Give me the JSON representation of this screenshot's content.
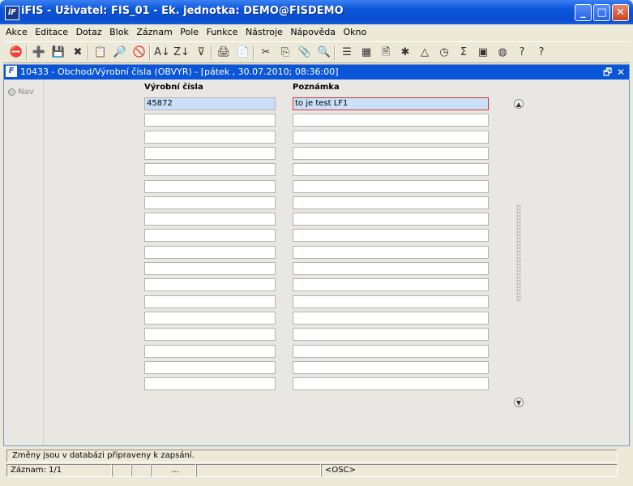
{
  "window": {
    "title": "iFIS - Uživatel: FIS_01 - Ek. jednotka: DEMO@FISDEMO",
    "app_icon": "iF",
    "minimize_icon": "_",
    "maximize_icon": "□",
    "close_icon": "✕"
  },
  "menu": [
    "Akce",
    "Editace",
    "Dotaz",
    "Blok",
    "Záznam",
    "Pole",
    "Funkce",
    "Nástroje",
    "Nápověda",
    "Okno"
  ],
  "toolbar": {
    "buttons": [
      {
        "icon": "exit-icon",
        "glyph": "⛔"
      },
      {
        "icon": "insert-record-icon",
        "glyph": "➕"
      },
      {
        "icon": "save-icon",
        "glyph": "💾"
      },
      {
        "icon": "delete-record-icon",
        "glyph": "✖"
      },
      {
        "icon": "query-icon",
        "glyph": "📋"
      },
      {
        "icon": "execute-query-icon",
        "glyph": "🔎"
      },
      {
        "icon": "cancel-query-icon",
        "glyph": "🚫"
      },
      {
        "icon": "sort-asc-icon",
        "glyph": "A↓"
      },
      {
        "icon": "sort-desc-icon",
        "glyph": "Z↓"
      },
      {
        "icon": "filter-icon",
        "glyph": "⊽"
      },
      {
        "icon": "print-icon",
        "glyph": "🖨"
      },
      {
        "icon": "print-preview-icon",
        "glyph": "📄"
      },
      {
        "icon": "cut-icon",
        "glyph": "✂"
      },
      {
        "icon": "copy-icon",
        "glyph": "⎘"
      },
      {
        "icon": "paste-icon",
        "glyph": "📎"
      },
      {
        "icon": "find-icon",
        "glyph": "🔍"
      },
      {
        "icon": "list-icon",
        "glyph": "☰"
      },
      {
        "icon": "columns-icon",
        "glyph": "▦"
      },
      {
        "icon": "form-icon",
        "glyph": "🗎"
      },
      {
        "icon": "tools-icon",
        "glyph": "✱"
      },
      {
        "icon": "triangle-icon",
        "glyph": "△"
      },
      {
        "icon": "clock-icon",
        "glyph": "◷"
      },
      {
        "icon": "sum-icon",
        "glyph": "Σ"
      },
      {
        "icon": "excel-icon",
        "glyph": "▣"
      },
      {
        "icon": "globe-icon",
        "glyph": "◍"
      },
      {
        "icon": "help-icon",
        "glyph": "?"
      },
      {
        "icon": "context-help-icon",
        "glyph": "?"
      }
    ]
  },
  "form": {
    "title": "10433 - Obchod/Výrobní čísla (OBVYR) - [pátek , 30.07.2010; 08:36:00]",
    "form_icon": "F",
    "restore_icon": "🗗",
    "close_icon": "✕",
    "nav_label": "Nav",
    "columns": {
      "serial_number": "Výrobní čísla",
      "note": "Poznámka"
    },
    "rows": [
      {
        "serial_number": "45872",
        "note": "to je test LF1"
      },
      {
        "serial_number": "",
        "note": ""
      },
      {
        "serial_number": "",
        "note": ""
      },
      {
        "serial_number": "",
        "note": ""
      },
      {
        "serial_number": "",
        "note": ""
      },
      {
        "serial_number": "",
        "note": ""
      },
      {
        "serial_number": "",
        "note": ""
      },
      {
        "serial_number": "",
        "note": ""
      },
      {
        "serial_number": "",
        "note": ""
      },
      {
        "serial_number": "",
        "note": ""
      },
      {
        "serial_number": "",
        "note": ""
      },
      {
        "serial_number": "",
        "note": ""
      },
      {
        "serial_number": "",
        "note": ""
      },
      {
        "serial_number": "",
        "note": ""
      },
      {
        "serial_number": "",
        "note": ""
      },
      {
        "serial_number": "",
        "note": ""
      },
      {
        "serial_number": "",
        "note": ""
      },
      {
        "serial_number": "",
        "note": ""
      }
    ],
    "scroll_up_icon": "▲",
    "scroll_down_icon": "▼"
  },
  "status": {
    "message": "Změny jsou v databázi připraveny k zapsání.",
    "record": "Záznam: 1/1",
    "seg2": "",
    "seg3": "",
    "seg4": "...",
    "seg5": "",
    "mode": "<OSC>"
  }
}
